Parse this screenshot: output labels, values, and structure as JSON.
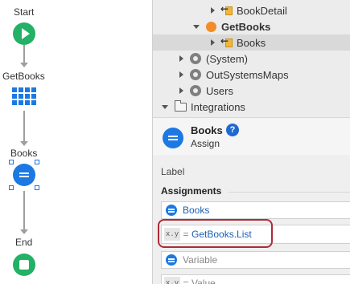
{
  "flow": {
    "start_label": "Start",
    "aggregate_label": "GetBooks",
    "assign_label": "Books",
    "end_label": "End"
  },
  "tree": {
    "items": [
      {
        "label": "BookDetail",
        "icon": "screen-icon"
      },
      {
        "label": "GetBooks",
        "icon": "aggregate-icon"
      },
      {
        "label": "Books",
        "icon": "output-parameter-icon"
      },
      {
        "label": "(System)",
        "icon": "module-icon"
      },
      {
        "label": "OutSystemsMaps",
        "icon": "module-icon"
      },
      {
        "label": "Users",
        "icon": "module-icon"
      },
      {
        "label": "Integrations",
        "icon": "folder-icon"
      }
    ]
  },
  "props": {
    "name": "Books",
    "type": "Assign",
    "help": "?",
    "label_field": "Label",
    "assignments_title": "Assignments",
    "rows": [
      {
        "variable": "Books"
      },
      {
        "xy": "x.y",
        "eq": "=",
        "value": "GetBooks.List"
      },
      {
        "variable_placeholder": "Variable"
      },
      {
        "xy": "x.y",
        "eq": "=",
        "value_placeholder": "Value"
      }
    ]
  },
  "colors": {
    "start_end": "#23b067",
    "accent": "#1c78e3",
    "highlight": "#b02a3a",
    "aggregate_orange": "#f28d27"
  }
}
